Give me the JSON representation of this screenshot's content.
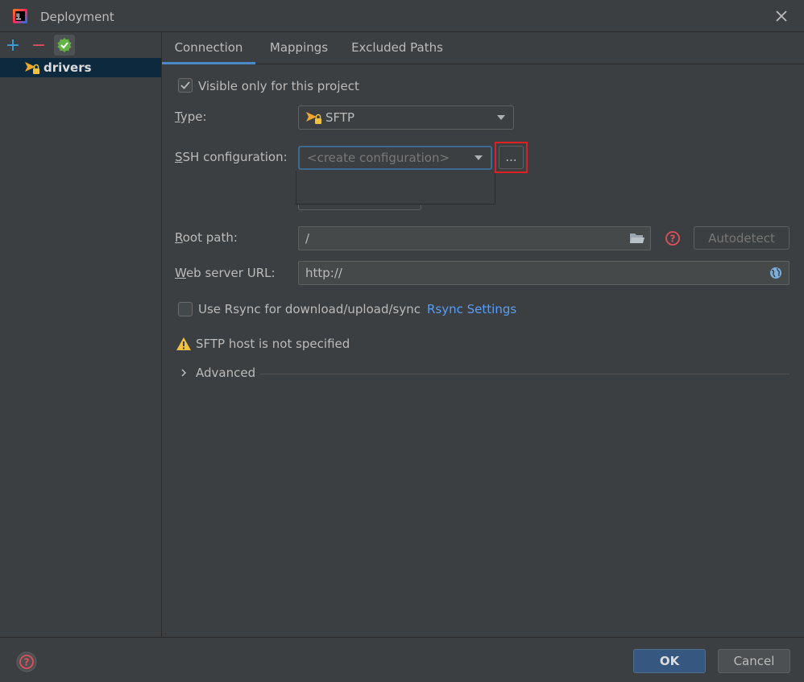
{
  "window": {
    "title": "Deployment"
  },
  "toolbar": {
    "add": "+",
    "remove": "−"
  },
  "tree": {
    "items": [
      {
        "label": "drivers"
      }
    ]
  },
  "tabs": [
    {
      "label": "Connection"
    },
    {
      "label": "Mappings"
    },
    {
      "label": "Excluded Paths"
    }
  ],
  "connection": {
    "visible_only_label": "Visible only for this project",
    "type_label_mnemonic": "T",
    "type_label_rest": "ype:",
    "type_value": "SFTP",
    "ssh_label_mnemonic": "S",
    "ssh_label_rest": "SH configuration:",
    "ssh_placeholder": "<create configuration>",
    "ssh_more_button": "...",
    "root_label_mnemonic": "R",
    "root_label_rest": "oot path:",
    "root_value": "/",
    "autodetect_button": "Autodetect",
    "web_label_mnemonic": "W",
    "web_label_rest": "eb server URL:",
    "web_value": "http://",
    "rsync_label": "Use Rsync for download/upload/sync",
    "rsync_link": "Rsync Settings",
    "warning_text": "SFTP host is not specified",
    "advanced_label": "Advanced"
  },
  "footer": {
    "ok": "OK",
    "cancel": "Cancel"
  },
  "colors": {
    "accent": "#4a88c7",
    "highlight": "#e02020",
    "warning": "#f0c040",
    "link": "#589df6"
  }
}
